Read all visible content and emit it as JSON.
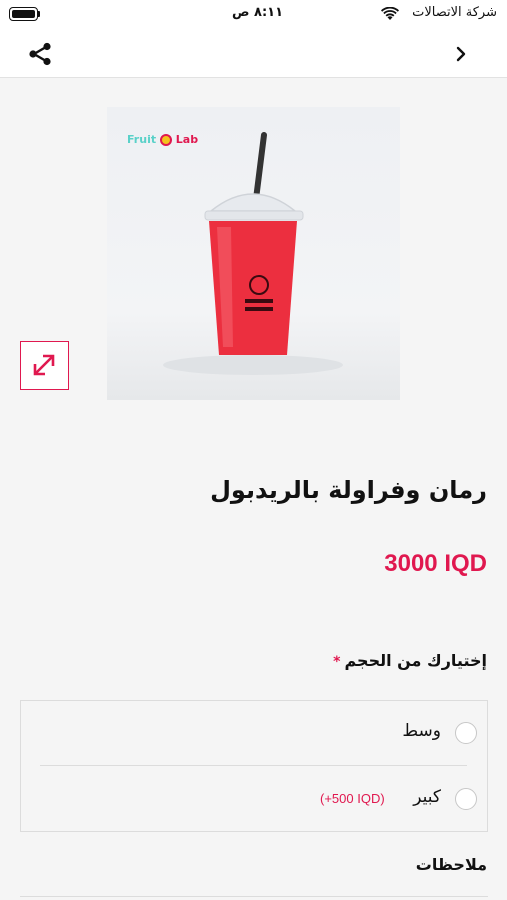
{
  "status_bar": {
    "carrier": "شركة الاتصالات",
    "time": "٨:١١ ص"
  },
  "nav": {
    "share_icon": "share-icon",
    "back_icon": "chevron-right-icon"
  },
  "product": {
    "logo_text_left": "Fruit",
    "logo_text_right": "Lab",
    "title": "رمان وفراولة بالريدبول",
    "price": "3000 IQD"
  },
  "size": {
    "label": "إختيارك من الحجم",
    "required_mark": "*",
    "options": [
      {
        "label": "وسط",
        "extra": ""
      },
      {
        "label": "كبير",
        "extra": "(+500 IQD)"
      }
    ]
  },
  "notes": {
    "label": "ملاحظات"
  },
  "colors": {
    "accent": "#e0184f",
    "background": "#f5f5f5"
  }
}
